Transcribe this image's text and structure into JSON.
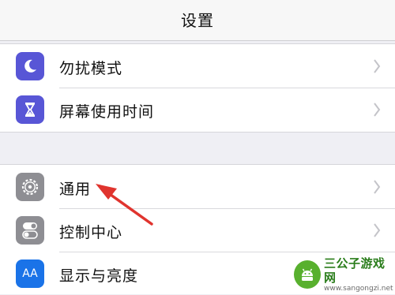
{
  "header": {
    "title": "设置"
  },
  "settings": {
    "group1": [
      {
        "label": "勿扰模式",
        "icon": "moon-icon",
        "color": "#5856d6"
      },
      {
        "label": "屏幕使用时间",
        "icon": "hourglass-icon",
        "color": "#5856d6"
      }
    ],
    "group2": [
      {
        "label": "通用",
        "icon": "gear-icon",
        "color": "#8e8e93"
      },
      {
        "label": "控制中心",
        "icon": "toggles-icon",
        "color": "#8e8e93"
      },
      {
        "label": "显示与亮度",
        "icon": "text-size-icon",
        "icon_text": "AA",
        "color": "#1a73e8"
      }
    ]
  },
  "annotation": {
    "color": "#e0342e"
  },
  "watermark": {
    "title": "三公子游戏网",
    "url": "www.sangongzi.net"
  }
}
